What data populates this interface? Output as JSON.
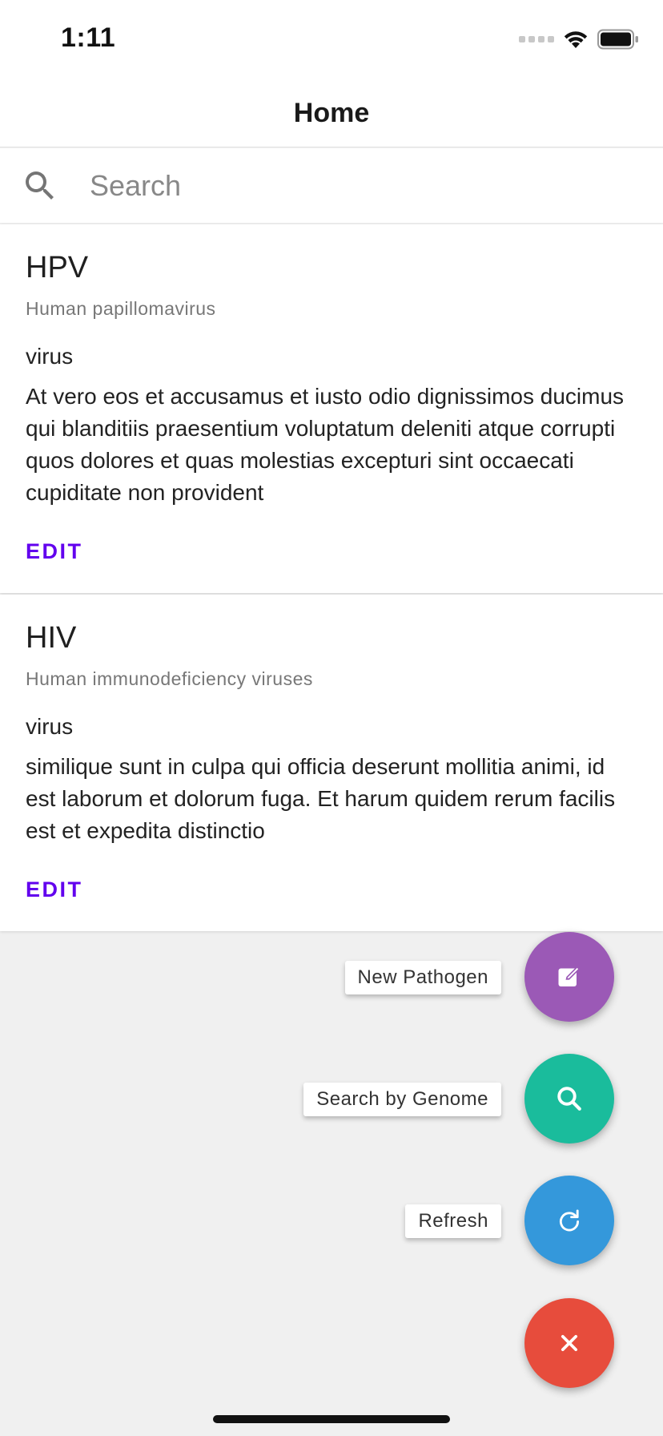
{
  "status_bar": {
    "time": "1:11"
  },
  "nav": {
    "title": "Home"
  },
  "search": {
    "placeholder": "Search",
    "value": ""
  },
  "pathogens": [
    {
      "name": "HPV",
      "full_name": "Human papillomavirus",
      "type": "virus",
      "description": "At vero eos et accusamus et iusto odio dignissimos ducimus qui blanditiis praesentium voluptatum deleniti atque corrupti quos dolores et quas molestias excepturi sint occaecati cupiditate non provident",
      "edit_label": "EDIT"
    },
    {
      "name": "HIV",
      "full_name": "Human immunodeficiency viruses",
      "type": "virus",
      "description": "similique sunt in culpa qui officia deserunt mollitia animi, id est laborum et dolorum fuga. Et harum quidem rerum facilis est et expedita distinctio",
      "edit_label": "EDIT"
    }
  ],
  "fab_menu": {
    "actions": [
      {
        "label": "New Pathogen",
        "icon": "edit-icon",
        "color": "#9b59b6"
      },
      {
        "label": "Search by Genome",
        "icon": "search-icon",
        "color": "#1abc9c"
      },
      {
        "label": "Refresh",
        "icon": "refresh-icon",
        "color": "#3498db"
      }
    ],
    "close": {
      "icon": "close-icon",
      "color": "#e74c3c"
    }
  },
  "colors": {
    "accent": "#6200ee",
    "background": "#f0f0f0"
  }
}
